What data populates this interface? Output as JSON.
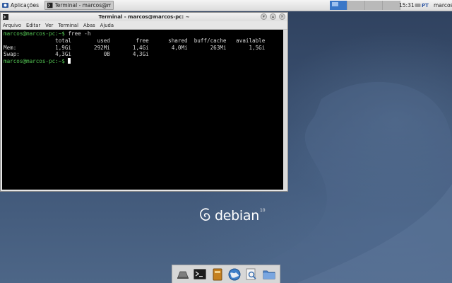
{
  "panel": {
    "apps_label": "Aplicações",
    "task_label": "Terminal - marcos@mar...",
    "clock": "15:31",
    "keyboard_layout": "PT",
    "user": "marcos"
  },
  "window": {
    "title": "Terminal - marcos@marcos-pc: ~",
    "menu": [
      "Arquivo",
      "Editar",
      "Ver",
      "Terminal",
      "Abas",
      "Ajuda"
    ]
  },
  "terminal": {
    "prompt": "marcos@marcos-pc:~$",
    "command": " free -h",
    "table_lines": [
      "                total        used        free      shared  buff/cache   available",
      "Mem:            1,9Gi       292Mi       1,4Gi       4,0Mi       263Mi       1,5Gi",
      "Swap:           4,3Gi          0B       4,3Gi"
    ],
    "prompt2": "marcos@marcos-pc:~$",
    "cursor_text": " "
  },
  "desktop": {
    "brand": "debian",
    "version": "10"
  },
  "dock": {
    "items": [
      "show-desktop-icon",
      "terminal-icon",
      "file-manager-icon",
      "web-browser-icon",
      "search-icon",
      "folder-icon"
    ]
  },
  "colors": {
    "prompt": "#53c653",
    "workspace_active": "#3a77c7"
  }
}
